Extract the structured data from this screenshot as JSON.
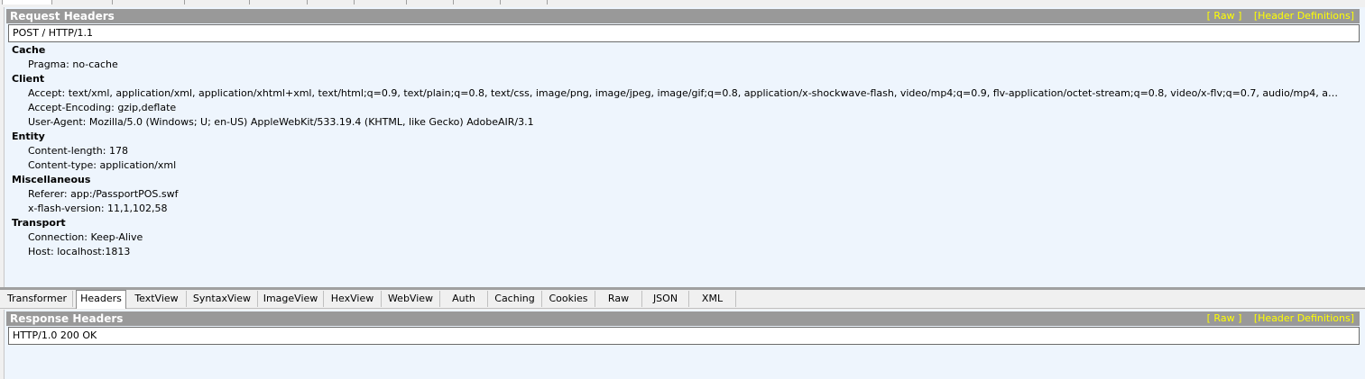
{
  "request": {
    "title": "Request Headers",
    "raw_link": "[ Raw ]",
    "defs_link": "[Header Definitions]",
    "request_line": "POST / HTTP/1.1",
    "groups": [
      {
        "name": "Cache",
        "items": [
          "Pragma: no-cache"
        ]
      },
      {
        "name": "Client",
        "items": [
          "Accept: text/xml, application/xml, application/xhtml+xml, text/html;q=0.9, text/plain;q=0.8, text/css, image/png, image/jpeg, image/gif;q=0.8, application/x-shockwave-flash, video/mp4;q=0.9, flv-application/octet-stream;q=0.8, video/x-flv;q=0.7, audio/mp4, a…",
          "Accept-Encoding: gzip,deflate",
          "User-Agent: Mozilla/5.0 (Windows; U; en-US) AppleWebKit/533.19.4 (KHTML, like Gecko) AdobeAIR/3.1"
        ]
      },
      {
        "name": "Entity",
        "items": [
          "Content-length: 178",
          "Content-type: application/xml"
        ]
      },
      {
        "name": "Miscellaneous",
        "items": [
          "Referer: app:/PassportPOS.swf",
          "x-flash-version: 11,1,102,58"
        ]
      },
      {
        "name": "Transport",
        "items": [
          "Connection: Keep-Alive",
          "Host: localhost:1813"
        ]
      }
    ]
  },
  "response_tabs": [
    "Transformer",
    "Headers",
    "TextView",
    "SyntaxView",
    "ImageView",
    "HexView",
    "WebView",
    "Auth",
    "Caching",
    "Cookies",
    "Raw",
    "JSON",
    "XML"
  ],
  "active_tab": "Headers",
  "response": {
    "title": "Response Headers",
    "raw_link": "[ Raw ]",
    "defs_link": "[Header Definitions]",
    "status_line": "HTTP/1.0 200 OK"
  }
}
